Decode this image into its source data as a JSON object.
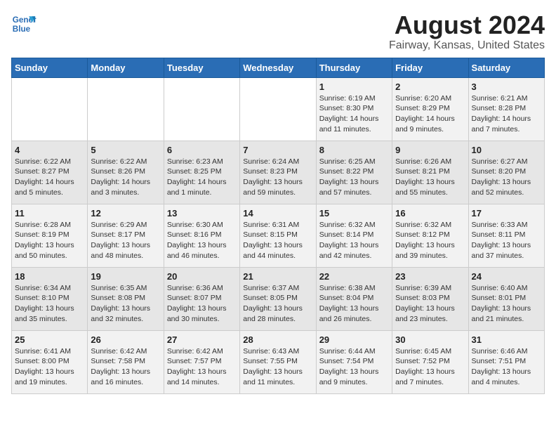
{
  "logo": {
    "line1": "General",
    "line2": "Blue"
  },
  "title": "August 2024",
  "subtitle": "Fairway, Kansas, United States",
  "days_of_week": [
    "Sunday",
    "Monday",
    "Tuesday",
    "Wednesday",
    "Thursday",
    "Friday",
    "Saturday"
  ],
  "weeks": [
    [
      {
        "day": "",
        "content": ""
      },
      {
        "day": "",
        "content": ""
      },
      {
        "day": "",
        "content": ""
      },
      {
        "day": "",
        "content": ""
      },
      {
        "day": "1",
        "content": "Sunrise: 6:19 AM\nSunset: 8:30 PM\nDaylight: 14 hours and 11 minutes."
      },
      {
        "day": "2",
        "content": "Sunrise: 6:20 AM\nSunset: 8:29 PM\nDaylight: 14 hours and 9 minutes."
      },
      {
        "day": "3",
        "content": "Sunrise: 6:21 AM\nSunset: 8:28 PM\nDaylight: 14 hours and 7 minutes."
      }
    ],
    [
      {
        "day": "4",
        "content": "Sunrise: 6:22 AM\nSunset: 8:27 PM\nDaylight: 14 hours and 5 minutes."
      },
      {
        "day": "5",
        "content": "Sunrise: 6:22 AM\nSunset: 8:26 PM\nDaylight: 14 hours and 3 minutes."
      },
      {
        "day": "6",
        "content": "Sunrise: 6:23 AM\nSunset: 8:25 PM\nDaylight: 14 hours and 1 minute."
      },
      {
        "day": "7",
        "content": "Sunrise: 6:24 AM\nSunset: 8:23 PM\nDaylight: 13 hours and 59 minutes."
      },
      {
        "day": "8",
        "content": "Sunrise: 6:25 AM\nSunset: 8:22 PM\nDaylight: 13 hours and 57 minutes."
      },
      {
        "day": "9",
        "content": "Sunrise: 6:26 AM\nSunset: 8:21 PM\nDaylight: 13 hours and 55 minutes."
      },
      {
        "day": "10",
        "content": "Sunrise: 6:27 AM\nSunset: 8:20 PM\nDaylight: 13 hours and 52 minutes."
      }
    ],
    [
      {
        "day": "11",
        "content": "Sunrise: 6:28 AM\nSunset: 8:19 PM\nDaylight: 13 hours and 50 minutes."
      },
      {
        "day": "12",
        "content": "Sunrise: 6:29 AM\nSunset: 8:17 PM\nDaylight: 13 hours and 48 minutes."
      },
      {
        "day": "13",
        "content": "Sunrise: 6:30 AM\nSunset: 8:16 PM\nDaylight: 13 hours and 46 minutes."
      },
      {
        "day": "14",
        "content": "Sunrise: 6:31 AM\nSunset: 8:15 PM\nDaylight: 13 hours and 44 minutes."
      },
      {
        "day": "15",
        "content": "Sunrise: 6:32 AM\nSunset: 8:14 PM\nDaylight: 13 hours and 42 minutes."
      },
      {
        "day": "16",
        "content": "Sunrise: 6:32 AM\nSunset: 8:12 PM\nDaylight: 13 hours and 39 minutes."
      },
      {
        "day": "17",
        "content": "Sunrise: 6:33 AM\nSunset: 8:11 PM\nDaylight: 13 hours and 37 minutes."
      }
    ],
    [
      {
        "day": "18",
        "content": "Sunrise: 6:34 AM\nSunset: 8:10 PM\nDaylight: 13 hours and 35 minutes."
      },
      {
        "day": "19",
        "content": "Sunrise: 6:35 AM\nSunset: 8:08 PM\nDaylight: 13 hours and 32 minutes."
      },
      {
        "day": "20",
        "content": "Sunrise: 6:36 AM\nSunset: 8:07 PM\nDaylight: 13 hours and 30 minutes."
      },
      {
        "day": "21",
        "content": "Sunrise: 6:37 AM\nSunset: 8:05 PM\nDaylight: 13 hours and 28 minutes."
      },
      {
        "day": "22",
        "content": "Sunrise: 6:38 AM\nSunset: 8:04 PM\nDaylight: 13 hours and 26 minutes."
      },
      {
        "day": "23",
        "content": "Sunrise: 6:39 AM\nSunset: 8:03 PM\nDaylight: 13 hours and 23 minutes."
      },
      {
        "day": "24",
        "content": "Sunrise: 6:40 AM\nSunset: 8:01 PM\nDaylight: 13 hours and 21 minutes."
      }
    ],
    [
      {
        "day": "25",
        "content": "Sunrise: 6:41 AM\nSunset: 8:00 PM\nDaylight: 13 hours and 19 minutes."
      },
      {
        "day": "26",
        "content": "Sunrise: 6:42 AM\nSunset: 7:58 PM\nDaylight: 13 hours and 16 minutes."
      },
      {
        "day": "27",
        "content": "Sunrise: 6:42 AM\nSunset: 7:57 PM\nDaylight: 13 hours and 14 minutes."
      },
      {
        "day": "28",
        "content": "Sunrise: 6:43 AM\nSunset: 7:55 PM\nDaylight: 13 hours and 11 minutes."
      },
      {
        "day": "29",
        "content": "Sunrise: 6:44 AM\nSunset: 7:54 PM\nDaylight: 13 hours and 9 minutes."
      },
      {
        "day": "30",
        "content": "Sunrise: 6:45 AM\nSunset: 7:52 PM\nDaylight: 13 hours and 7 minutes."
      },
      {
        "day": "31",
        "content": "Sunrise: 6:46 AM\nSunset: 7:51 PM\nDaylight: 13 hours and 4 minutes."
      }
    ]
  ]
}
